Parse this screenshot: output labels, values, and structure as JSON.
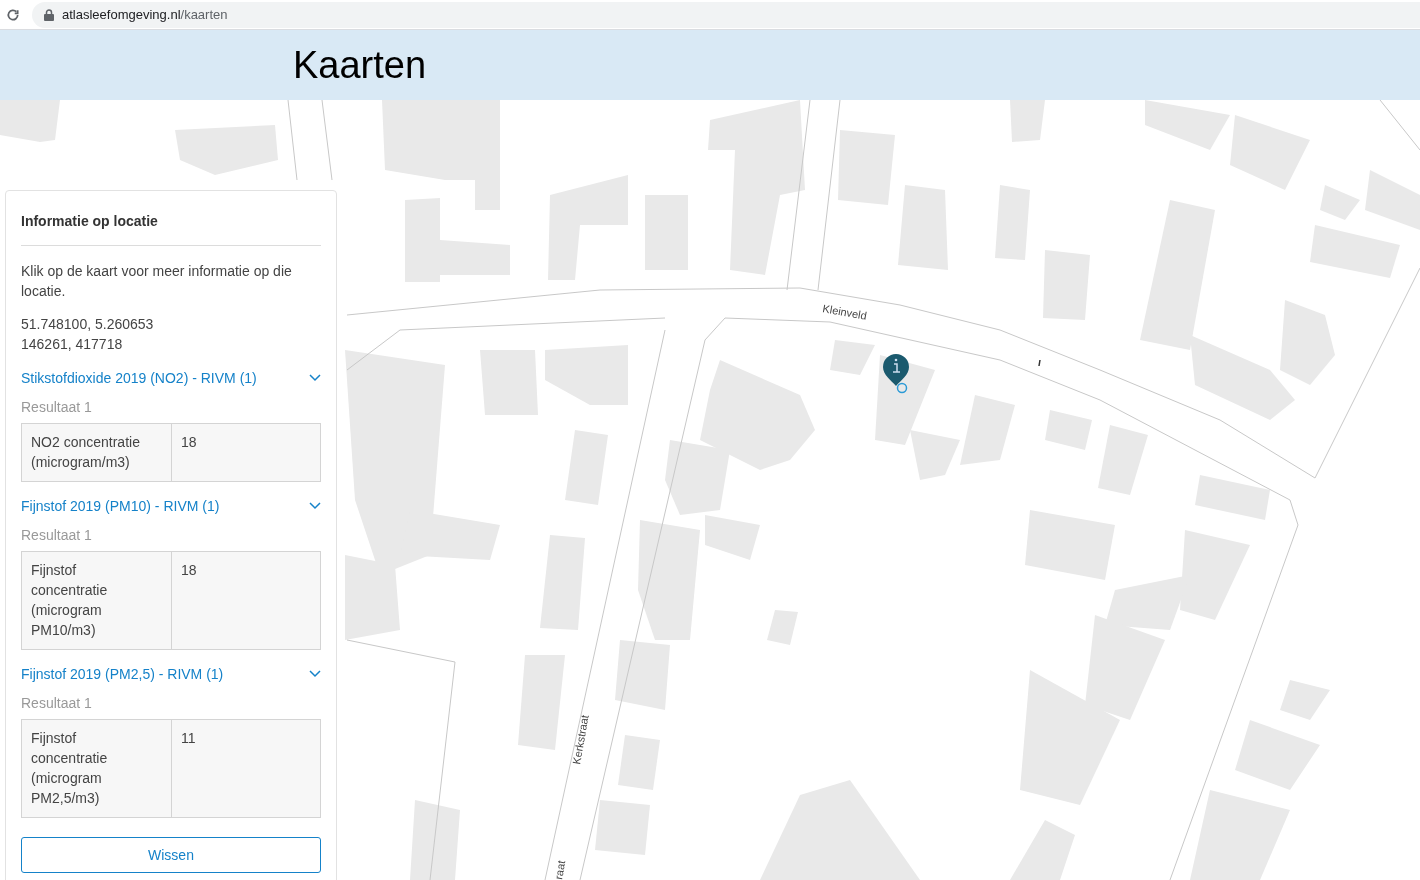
{
  "browser": {
    "domain": "atlasleefomgeving.nl",
    "path": "/kaarten"
  },
  "header": {
    "title": "Kaarten"
  },
  "map": {
    "street_labels": [
      "Kleinveld",
      "Kerkstraat",
      "raat"
    ]
  },
  "panel": {
    "title": "Informatie op locatie",
    "intro": "Klik op de kaart voor meer informatie op die locatie.",
    "coordinates": [
      "51.748100, 5.260653",
      "146261, 417718"
    ],
    "sections": [
      {
        "title": "Stikstofdioxide 2019 (NO2) - RIVM (1)",
        "result_label": "Resultaat 1",
        "rows": [
          {
            "label": "NO2 concentratie (microgram/m3)",
            "value": "18"
          }
        ]
      },
      {
        "title": "Fijnstof 2019 (PM10) - RIVM (1)",
        "result_label": "Resultaat 1",
        "rows": [
          {
            "label": "Fijnstof concentratie (microgram PM10/m3)",
            "value": "18"
          }
        ]
      },
      {
        "title": "Fijnstof 2019 (PM2,5) - RIVM (1)",
        "result_label": "Resultaat 1",
        "rows": [
          {
            "label": "Fijnstof concentratie (microgram PM2,5/m3)",
            "value": "11"
          }
        ]
      }
    ],
    "button": "Wissen"
  }
}
